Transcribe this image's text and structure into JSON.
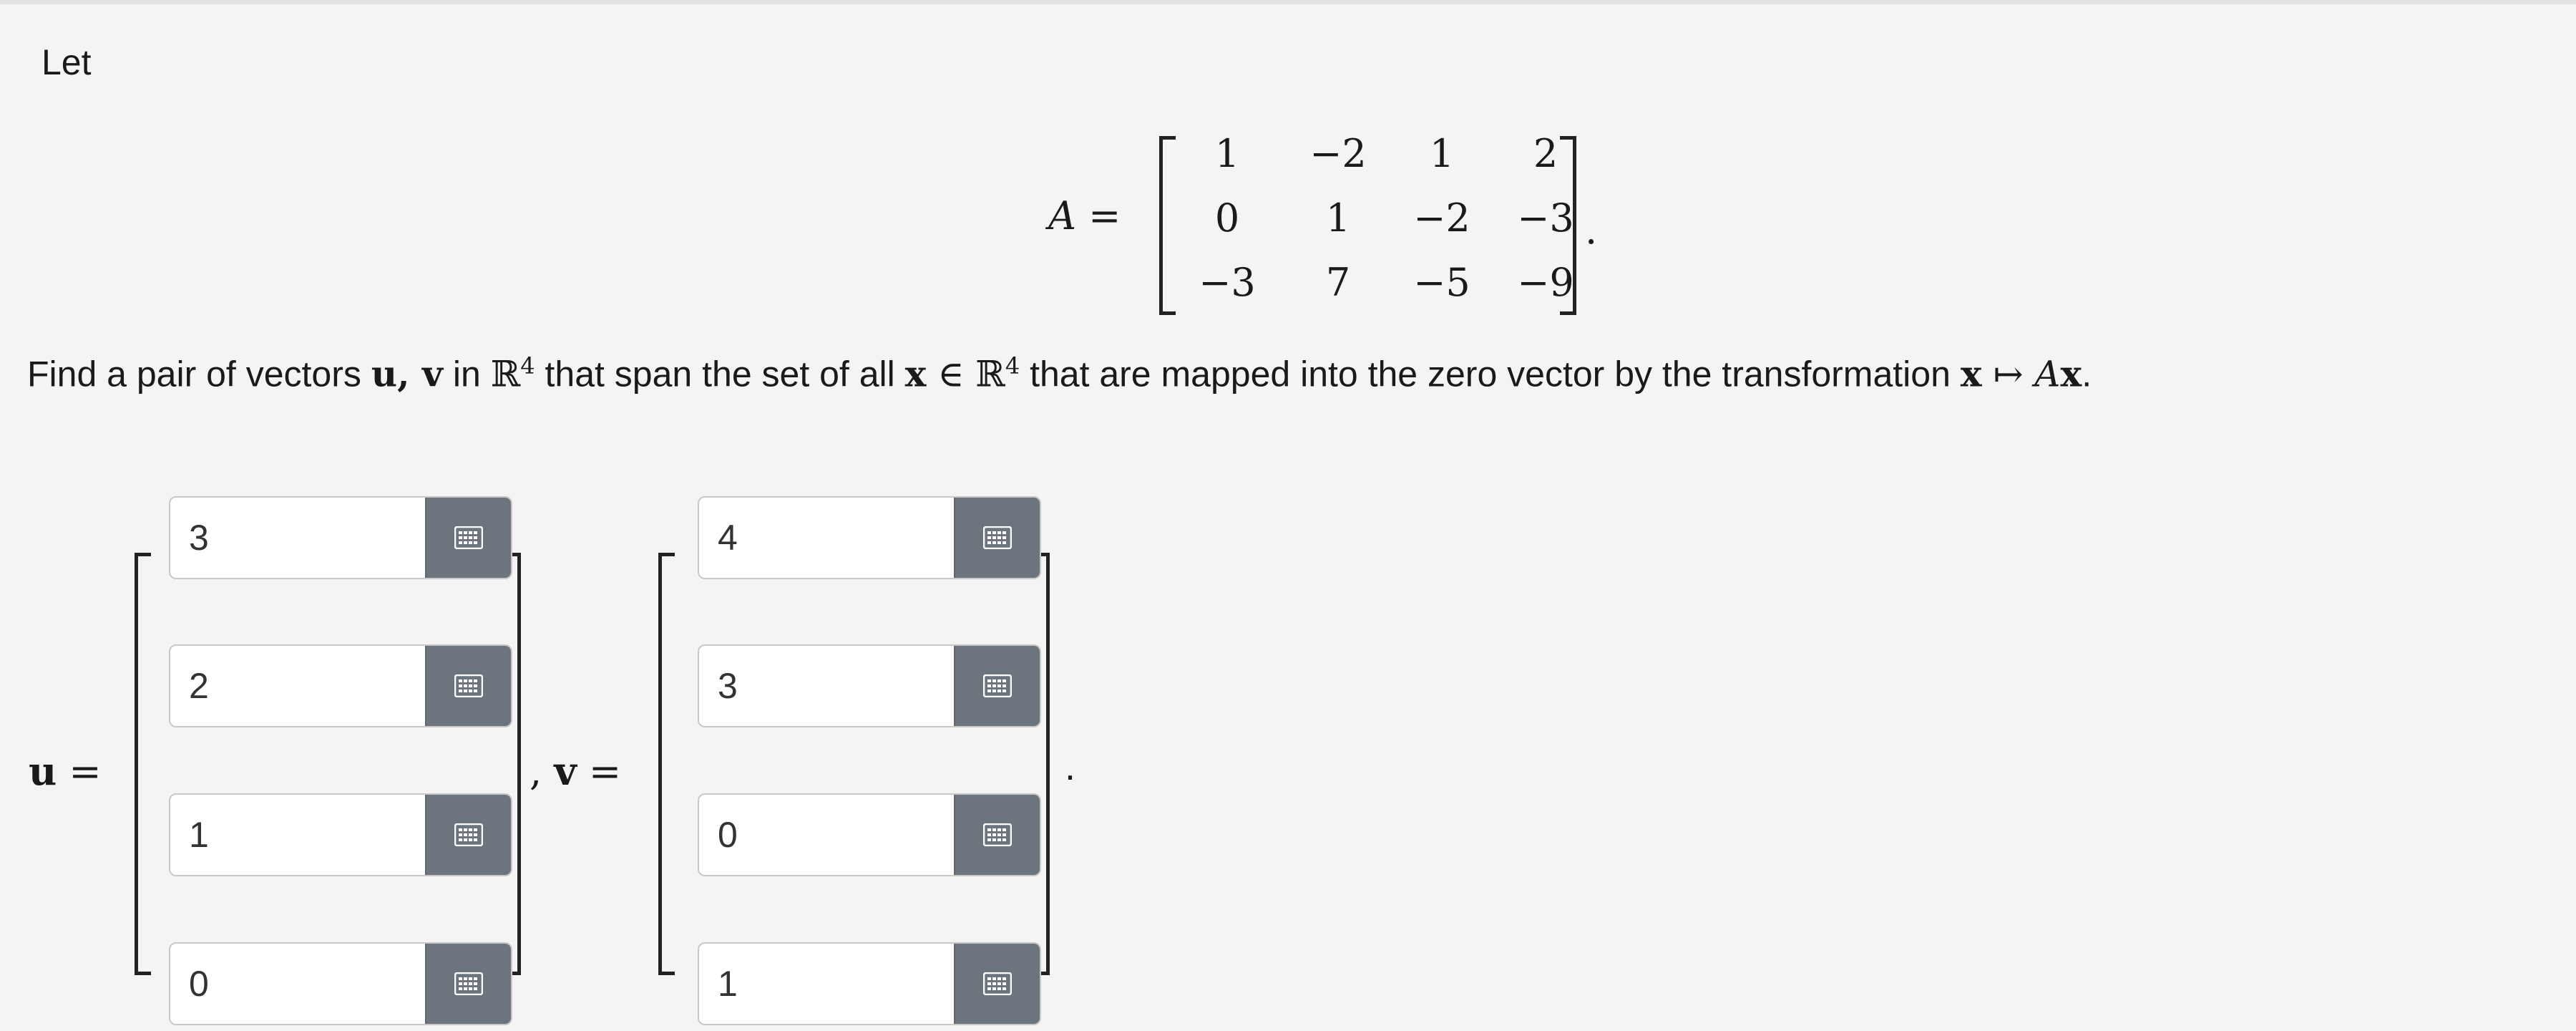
{
  "intro": "Let",
  "matrix": {
    "lhs": "A =",
    "rows": [
      [
        "1",
        "−2",
        "1",
        "2"
      ],
      [
        "0",
        "1",
        "−2",
        "−3"
      ],
      [
        "−3",
        "7",
        "−5",
        "−9"
      ]
    ],
    "trailing": "."
  },
  "problem": {
    "p1": "Find a pair of vectors ",
    "uv": "u, v",
    "p2": " in ",
    "R": "ℝ",
    "exp": "4",
    "p3": " that span the set of all ",
    "x": "x",
    "in": " ∈ ",
    "p4": " that are mapped into the zero vector by the transformation ",
    "maps": " ↦ ",
    "A": "A",
    "end": "."
  },
  "answer": {
    "u_label": "u",
    "v_label": "v",
    "eq": " =",
    "comma": ",",
    "period": ".",
    "u": [
      "3",
      "2",
      "1",
      "0"
    ],
    "v": [
      "4",
      "3",
      "0",
      "1"
    ]
  },
  "icons": {
    "keyboard": "matrix-keypad-icon"
  },
  "colors": {
    "keypad_button": "#6c757d",
    "background": "#f4f4f4"
  }
}
